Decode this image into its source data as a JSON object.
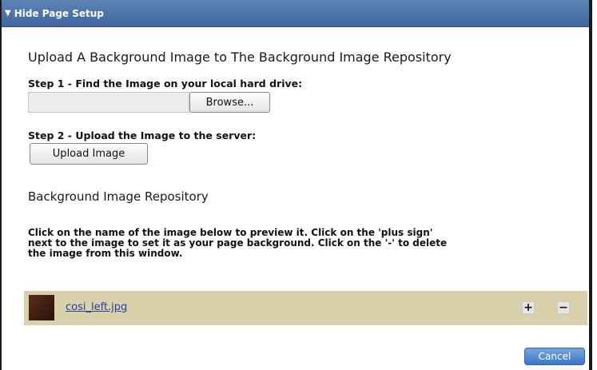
{
  "header": {
    "toggle_icon": "triangle-down-icon",
    "title": "Hide Page Setup"
  },
  "upload": {
    "heading": "Upload A Background Image to The Background Image Repository",
    "step1": "Step 1 - Find the Image on your local hard drive:",
    "file_value": "",
    "browse_label": "Browse...",
    "step2": "Step 2 - Upload the Image to the server:",
    "upload_label": "Upload Image"
  },
  "repository": {
    "heading": "Background Image Repository",
    "instructions": [
      "Click on the name of the image below to preview it. Click on the 'plus sign'",
      "next to the image to set it as your page background. Click on the '-' to delete",
      "the image from this window."
    ],
    "images": [
      {
        "name": "cosi_left.jpg",
        "add_icon": "plus-icon",
        "delete_icon": "minus-icon"
      }
    ]
  },
  "footer": {
    "cancel_label": "Cancel"
  },
  "colors": {
    "header": "#4a70aa",
    "row_bg": "#d8d1ab",
    "link": "#2a3f9e",
    "cancel": "#4a84d0"
  }
}
